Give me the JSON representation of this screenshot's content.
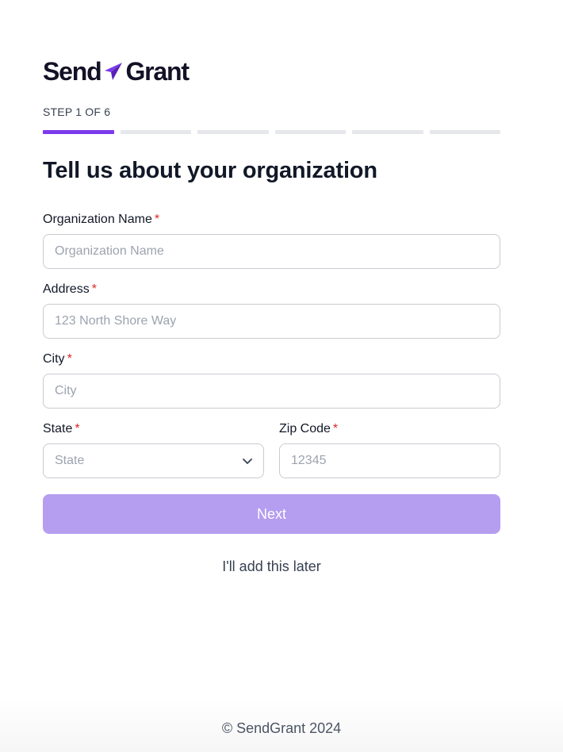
{
  "brand": {
    "name_part1": "Send",
    "name_part2": "Grant",
    "accent_color": "#7c3aed"
  },
  "progress": {
    "label": "STEP 1 OF 6",
    "current_step": 1,
    "total_steps": 6
  },
  "form": {
    "heading": "Tell us about your organization",
    "required_marker": "*",
    "organization_name": {
      "label": "Organization Name",
      "placeholder": "Organization Name",
      "value": ""
    },
    "address": {
      "label": "Address",
      "placeholder": "123 North Shore Way",
      "value": ""
    },
    "city": {
      "label": "City",
      "placeholder": "City",
      "value": ""
    },
    "state": {
      "label": "State",
      "selected": "State",
      "icon": "chevron-down-icon"
    },
    "zip": {
      "label": "Zip Code",
      "placeholder": "12345",
      "value": ""
    },
    "next_label": "Next",
    "skip_label": "I'll add this later"
  },
  "footer": {
    "copyright": "© SendGrant 2024"
  }
}
